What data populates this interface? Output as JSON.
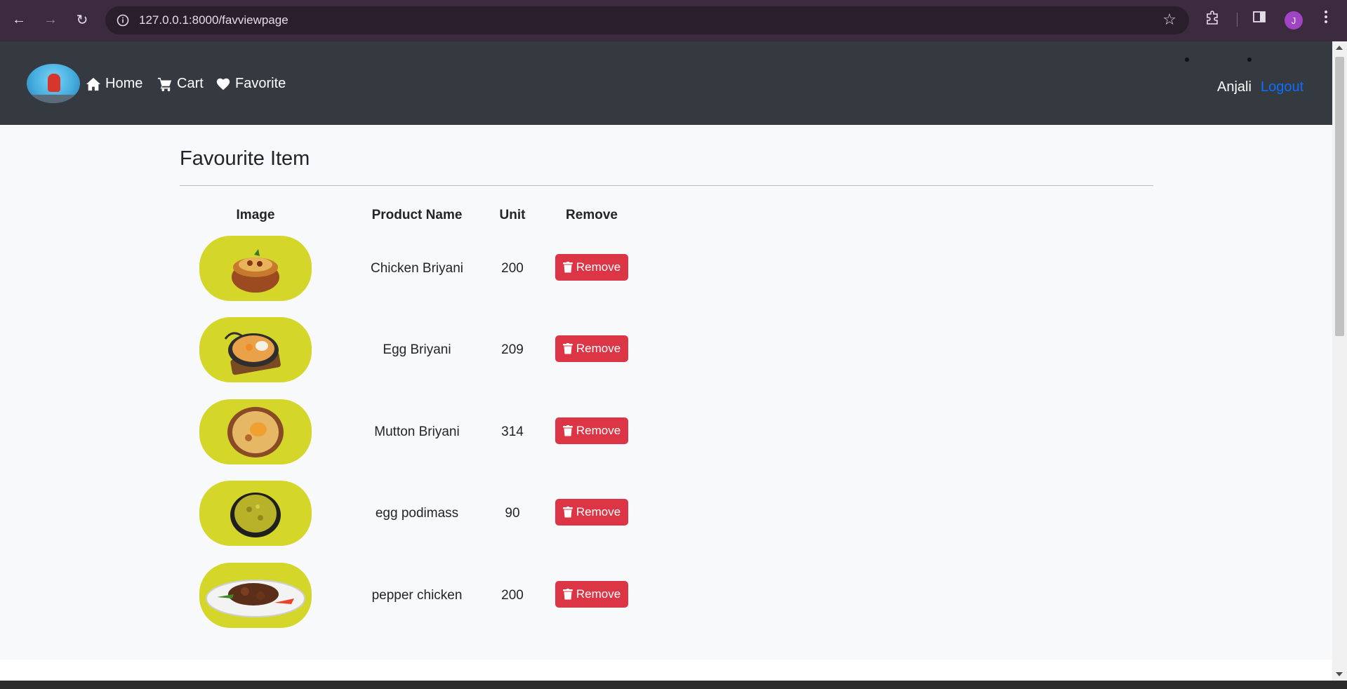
{
  "browser": {
    "url": "127.0.0.1:8000/favviewpage",
    "profile_initial": "J",
    "icons": [
      "back-arrow-icon",
      "forward-arrow-icon",
      "reload-icon",
      "site-info-icon",
      "bookmark-star-icon",
      "extensions-icon",
      "side-panel-icon",
      "profile-avatar",
      "more-menu-icon"
    ]
  },
  "navbar": {
    "links": [
      {
        "label": "Home",
        "icon": "home-icon"
      },
      {
        "label": "Cart",
        "icon": "cart-icon"
      },
      {
        "label": "Favorite",
        "icon": "heart-icon"
      }
    ],
    "user_name": "Anjali",
    "logout_label": "Logout"
  },
  "page": {
    "title": "Favourite Item",
    "columns": [
      "Image",
      "Product Name",
      "Unit",
      "Remove"
    ],
    "remove_label": "Remove",
    "items": [
      {
        "name": "Chicken Briyani",
        "unit": "200"
      },
      {
        "name": "Egg Briyani",
        "unit": "209"
      },
      {
        "name": "Mutton Briyani",
        "unit": "314"
      },
      {
        "name": "egg podimass",
        "unit": "90"
      },
      {
        "name": "pepper chicken",
        "unit": "200"
      }
    ]
  },
  "colors": {
    "navbar_bg": "#343a40",
    "image_bg": "#d4d62a",
    "remove_button": "#dc3545",
    "logout_link": "#0d6efd"
  }
}
